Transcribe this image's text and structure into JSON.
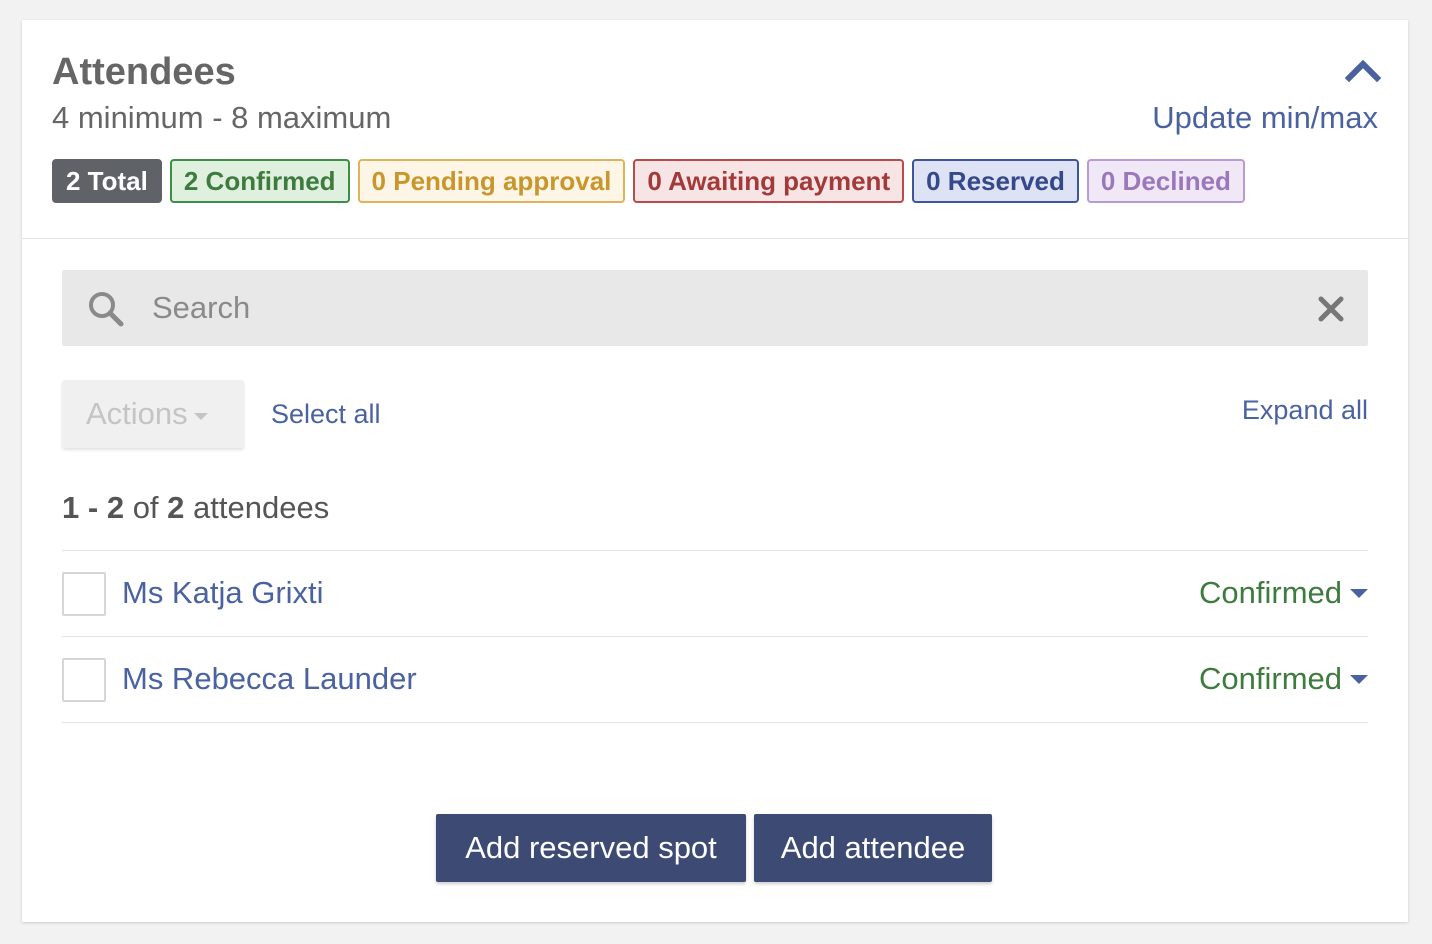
{
  "header": {
    "title": "Attendees",
    "subtitle": "4 minimum - 8 maximum",
    "update_link": "Update min/max"
  },
  "badges": {
    "total": "2 Total",
    "confirmed": "2 Confirmed",
    "pending": "0 Pending approval",
    "awaiting": "0 Awaiting payment",
    "reserved": "0 Reserved",
    "declined": "0 Declined"
  },
  "search": {
    "placeholder": "Search",
    "value": ""
  },
  "toolbar": {
    "actions_label": "Actions",
    "select_all": "Select all",
    "expand_all": "Expand all"
  },
  "count": {
    "start": "1",
    "end": "2",
    "of": "of",
    "total": "2",
    "suffix": "attendees"
  },
  "attendees": [
    {
      "name": "Ms Katja Grixti",
      "status": "Confirmed"
    },
    {
      "name": "Ms Rebecca Launder",
      "status": "Confirmed"
    }
  ],
  "footer": {
    "add_reserved": "Add reserved spot",
    "add_attendee": "Add attendee"
  },
  "colors": {
    "link": "#4a62a0",
    "confirmed": "#3e7b3e",
    "primary_button": "#3c4a74"
  },
  "icons": {
    "collapse": "chevron-up-icon",
    "search": "search-icon",
    "clear": "close-icon",
    "dropdown": "caret-down-icon"
  }
}
